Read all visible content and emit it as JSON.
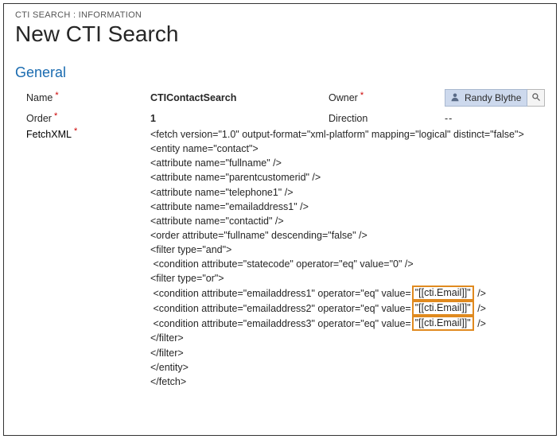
{
  "breadcrumb": "CTI SEARCH : INFORMATION",
  "page_title": "New CTI Search",
  "section": "General",
  "fields": {
    "name_label": "Name",
    "name_value": "CTIContactSearch",
    "owner_label": "Owner",
    "owner_value": "Randy Blythe",
    "order_label": "Order",
    "order_value": "1",
    "direction_label": "Direction",
    "direction_value": "--",
    "fetch_label": "FetchXML"
  },
  "fetchxml_lines": [
    "<fetch version=\"1.0\" output-format=\"xml-platform\" mapping=\"logical\" distinct=\"false\">",
    "<entity name=\"contact\">",
    "<attribute name=\"fullname\" />",
    "<attribute name=\"parentcustomerid\" />",
    "<attribute name=\"telephone1\" />",
    "<attribute name=\"emailaddress1\" />",
    "<attribute name=\"contactid\" />",
    "<order attribute=\"fullname\" descending=\"false\" />",
    "<filter type=\"and\">",
    " <condition attribute=\"statecode\" operator=\"eq\" value=\"0\" />",
    "<filter type=\"or\">"
  ],
  "email_conditions": [
    {
      "pre": " <condition attribute=\"emailaddress1\" operator=\"eq\" value=",
      "hl": "\"[[cti.Email]]\"",
      "post": " />"
    },
    {
      "pre": " <condition attribute=\"emailaddress2\" operator=\"eq\" value=",
      "hl": "\"[[cti.Email]]\"",
      "post": " />"
    },
    {
      "pre": " <condition attribute=\"emailaddress3\" operator=\"eq\" value=",
      "hl": "\"[[cti.Email]]\"",
      "post": " />"
    }
  ],
  "fetchxml_tail": [
    "</filter>",
    "</filter>",
    "</entity>",
    "</fetch>"
  ]
}
